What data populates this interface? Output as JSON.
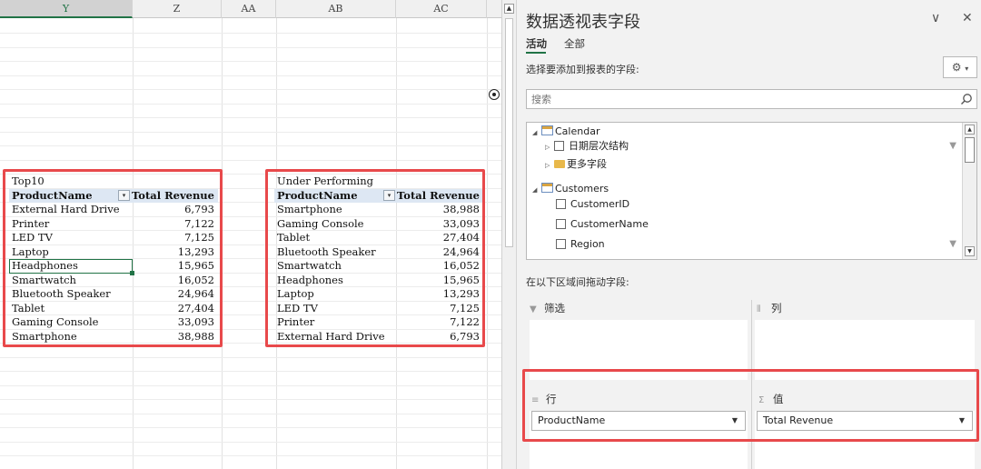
{
  "sheet": {
    "columns": [
      "Y",
      "Z",
      "AA",
      "AB",
      "AC"
    ],
    "selected_column": "Y",
    "top10": {
      "title": "Top10",
      "header": {
        "name": "ProductName",
        "value": "Total Revenue"
      },
      "rows": [
        {
          "name": "External Hard Drive",
          "value": "6,793"
        },
        {
          "name": "Printer",
          "value": "7,122"
        },
        {
          "name": "LED TV",
          "value": "7,125"
        },
        {
          "name": "Laptop",
          "value": "13,293"
        },
        {
          "name": "Headphones",
          "value": "15,965"
        },
        {
          "name": "Smartwatch",
          "value": "16,052"
        },
        {
          "name": "Bluetooth Speaker",
          "value": "24,964"
        },
        {
          "name": "Tablet",
          "value": "27,404"
        },
        {
          "name": "Gaming Console",
          "value": "33,093"
        },
        {
          "name": "Smartphone",
          "value": "38,988"
        }
      ]
    },
    "under": {
      "title": "Under Performing",
      "header": {
        "name": "ProductName",
        "value": "Total Revenue"
      },
      "rows": [
        {
          "name": "Smartphone",
          "value": "38,988"
        },
        {
          "name": "Gaming Console",
          "value": "33,093"
        },
        {
          "name": "Tablet",
          "value": "27,404"
        },
        {
          "name": "Bluetooth Speaker",
          "value": "24,964"
        },
        {
          "name": "Smartwatch",
          "value": "16,052"
        },
        {
          "name": "Headphones",
          "value": "15,965"
        },
        {
          "name": "Laptop",
          "value": "13,293"
        },
        {
          "name": "LED TV",
          "value": "7,125"
        },
        {
          "name": "Printer",
          "value": "7,122"
        },
        {
          "name": "External Hard Drive",
          "value": "6,793"
        }
      ]
    }
  },
  "pane": {
    "title": "数据透视表字段",
    "tabs": [
      "活动",
      "全部"
    ],
    "choose_label": "选择要添加到报表的字段:",
    "search_placeholder": "搜索",
    "fields": {
      "calendar": "Calendar",
      "date_hierarchy": "日期层次结构",
      "more_fields": "更多字段",
      "customers": "Customers",
      "customer_id": "CustomerID",
      "customer_name": "CustomerName",
      "region": "Region"
    },
    "drag_label": "在以下区域间拖动字段:",
    "areas": {
      "filter": "筛选",
      "columns": "列",
      "rows": "行",
      "values": "值"
    },
    "rows_field": "ProductName",
    "values_field": "Total Revenue"
  },
  "colors": {
    "accent_green": "#217346",
    "highlight_red": "#e8494b",
    "pivot_header_blue": "#dde7f3"
  }
}
